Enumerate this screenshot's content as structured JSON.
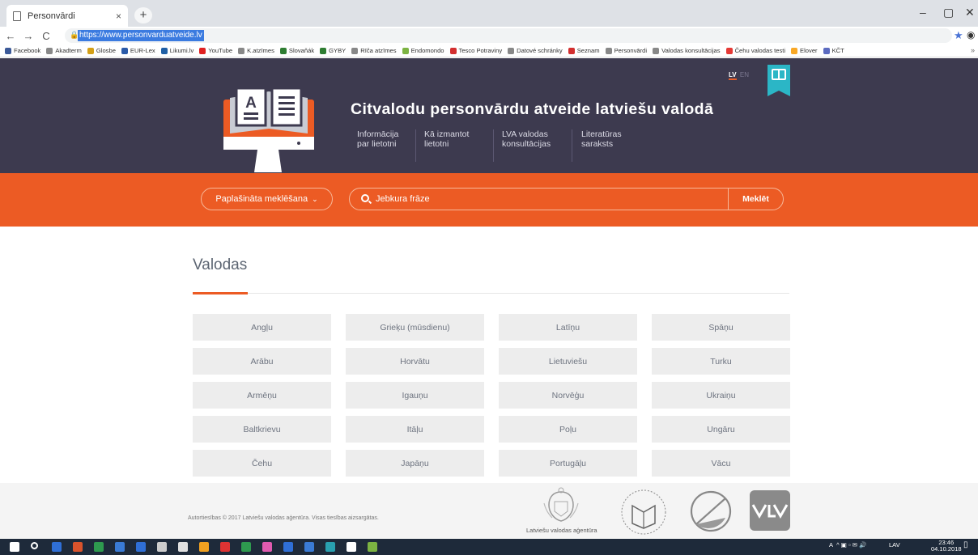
{
  "browser": {
    "tab_title": "Personvārdi",
    "tab_close": "×",
    "new_tab": "+",
    "url": "https://www.personvarduatveide.lv",
    "window_controls": [
      "–",
      "▢",
      "✕"
    ],
    "nav_buttons": [
      "←",
      "→",
      "C"
    ],
    "bookmarks": [
      {
        "label": "Facebook",
        "color": "#3b5998"
      },
      {
        "label": "Akadterm",
        "color": "#888888"
      },
      {
        "label": "Glosbe",
        "color": "#d4a017"
      },
      {
        "label": "EUR-Lex",
        "color": "#2a5aa8"
      },
      {
        "label": "Likumi.lv",
        "color": "#1f5fa5"
      },
      {
        "label": "YouTube",
        "color": "#e02020"
      },
      {
        "label": "K.atzīmes",
        "color": "#888888"
      },
      {
        "label": "Slovaňák",
        "color": "#2e7d32"
      },
      {
        "label": "GYBY",
        "color": "#2e7d32"
      },
      {
        "label": "Rīča atzīmes",
        "color": "#888888"
      },
      {
        "label": "Endomondo",
        "color": "#7cb342"
      },
      {
        "label": "Tesco Potraviny",
        "color": "#d32f2f"
      },
      {
        "label": "Datové schránky",
        "color": "#888888"
      },
      {
        "label": "Seznam",
        "color": "#d32f2f"
      },
      {
        "label": "Personvārdi",
        "color": "#888888"
      },
      {
        "label": "Valodas konsultācijas",
        "color": "#888888"
      },
      {
        "label": "Čehu valodas testi",
        "color": "#e53935"
      },
      {
        "label": "Elover",
        "color": "#f9a825"
      },
      {
        "label": "KČT",
        "color": "#5c6bc0"
      }
    ],
    "bookmarks_more": "»"
  },
  "header": {
    "title": "Citvalodu personvārdu atveide latviešu valodā",
    "nav": [
      {
        "label": "Informācija par lietotni"
      },
      {
        "label": "Kā izmantot lietotni"
      },
      {
        "label": "LVA valodas konsultācijas"
      },
      {
        "label": "Literatūras saraksts"
      }
    ],
    "lang_active": "LV",
    "lang_other": "EN"
  },
  "search": {
    "advanced_label": "Paplašināta meklēšana",
    "advanced_chevron": "⌄",
    "placeholder": "Jebkura frāze",
    "submit_label": "Meklēt"
  },
  "languages": {
    "title": "Valodas",
    "items": [
      "Angļu",
      "Grieķu (mūsdienu)",
      "Latīņu",
      "Spāņu",
      "Arābu",
      "Horvātu",
      "Lietuviešu",
      "Turku",
      "Armēņu",
      "Igauņu",
      "Norvēģu",
      "Ukraiņu",
      "Baltkrievu",
      "Itāļu",
      "Poļu",
      "Ungāru",
      "Čehu",
      "Japāņu",
      "Portugāļu",
      "Vācu"
    ]
  },
  "footer": {
    "copyright": "Autortiesības © 2017 Latviešu valodas aģentūra. Visas tiesības aizsargātas.",
    "agency_name": "Latviešu valodas aģentūra"
  },
  "taskbar": {
    "time": "23:46",
    "date": "04.10.2018",
    "keyboard": "LAV"
  },
  "colors": {
    "header_bg": "#3d3a4f",
    "accent": "#ec5b24",
    "ribbon": "#2bb6c6"
  }
}
